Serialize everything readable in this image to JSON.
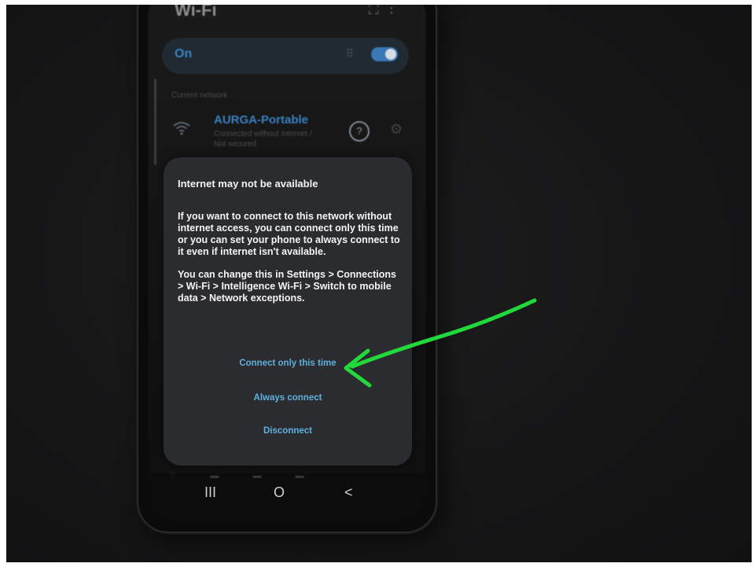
{
  "header": {
    "title": "Wi-Fi",
    "toggle_label": "On"
  },
  "networks": {
    "section_label": "Current network",
    "current": {
      "name": "AURGA-Portable",
      "status": "Connected without internet / Not secured"
    }
  },
  "dialog": {
    "title": "Internet may not be available",
    "paragraphs": [
      "If you want to connect to this network without internet access, you can connect only this time or you can set your phone to always connect to it even if internet isn't available.",
      "You can change this in Settings > Connections > Wi-Fi > Intelligence Wi-Fi > Switch to mobile data > Network exceptions."
    ],
    "actions": {
      "connect_once": "Connect only this time",
      "always_connect": "Always connect",
      "disconnect": "Disconnect"
    }
  },
  "nav": {
    "recents": "III",
    "home": "O",
    "back": "<"
  },
  "icons": {
    "wifi": "wifi-icon",
    "help": "help-icon",
    "settings": "gear-icon",
    "annotation": "arrow-icon"
  },
  "colors": {
    "accent": "#5fb0df",
    "annotation_arrow": "#22d83a",
    "dialog_bg": "#2a2c2f"
  }
}
